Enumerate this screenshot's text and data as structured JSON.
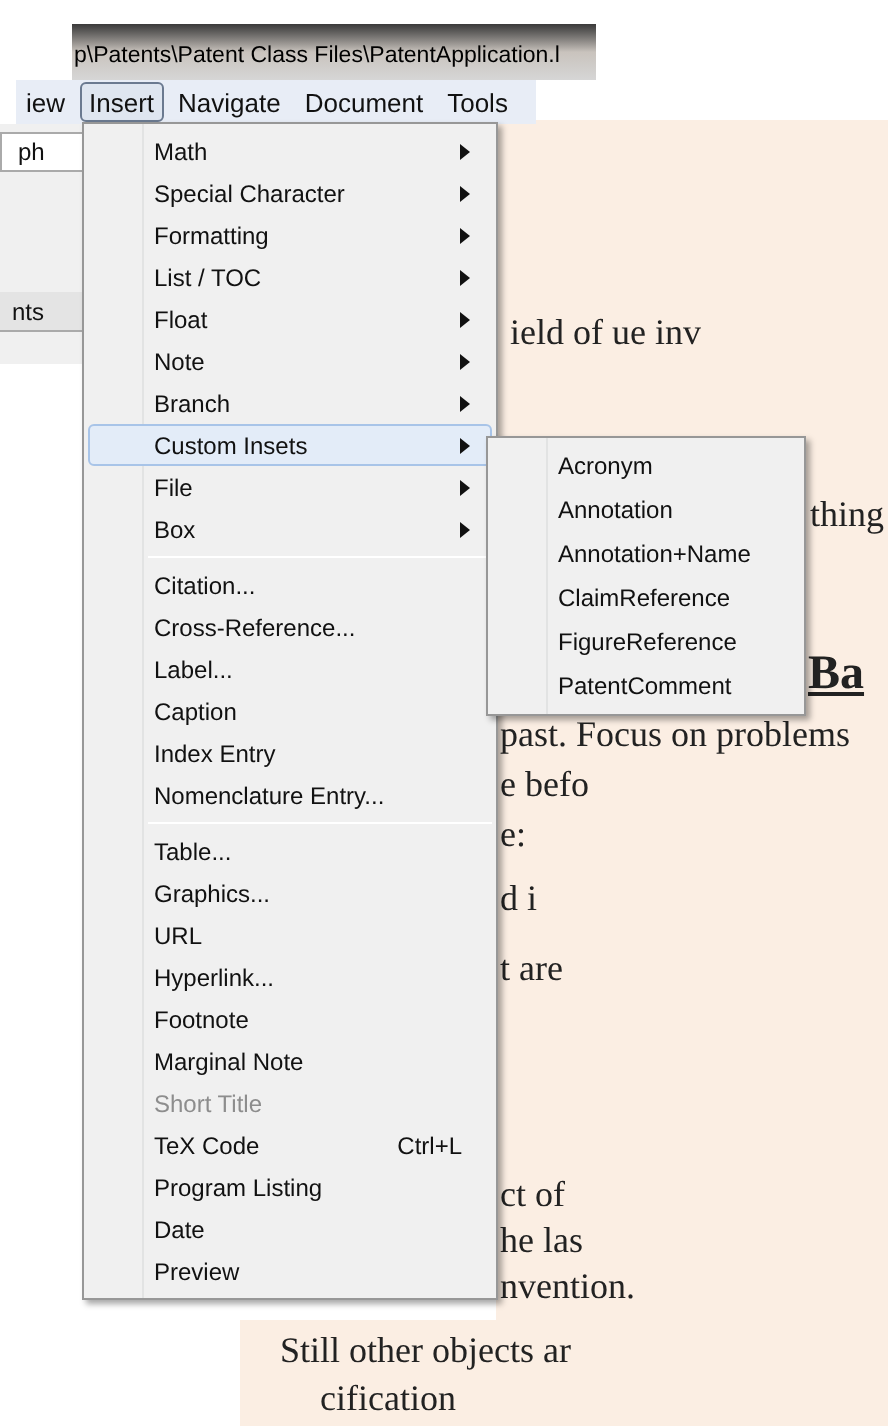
{
  "window": {
    "title": "p\\Patents\\Patent Class Files\\PatentApplication.l"
  },
  "menubar": [
    {
      "label": "iew",
      "selected": false
    },
    {
      "label": "Insert",
      "selected": true
    },
    {
      "label": "Navigate",
      "selected": false
    },
    {
      "label": "Document",
      "selected": false
    },
    {
      "label": "Tools",
      "selected": false
    }
  ],
  "sidebar": {
    "combo": "ph",
    "tab": "nts"
  },
  "insert_menu": [
    [
      {
        "label": "Math",
        "submenu": true,
        "selected": false,
        "disabled": false
      },
      {
        "label": "Special Character",
        "submenu": true,
        "selected": false,
        "disabled": false
      },
      {
        "label": "Formatting",
        "submenu": true,
        "selected": false,
        "disabled": false
      },
      {
        "label": "List / TOC",
        "submenu": true,
        "selected": false,
        "disabled": false
      },
      {
        "label": "Float",
        "submenu": true,
        "selected": false,
        "disabled": false
      },
      {
        "label": "Note",
        "submenu": true,
        "selected": false,
        "disabled": false
      },
      {
        "label": "Branch",
        "submenu": true,
        "selected": false,
        "disabled": false
      },
      {
        "label": "Custom Insets",
        "submenu": true,
        "selected": true,
        "disabled": false
      },
      {
        "label": "File",
        "submenu": true,
        "selected": false,
        "disabled": false
      },
      {
        "label": "Box",
        "submenu": true,
        "selected": false,
        "disabled": false
      }
    ],
    [
      {
        "label": "Citation...",
        "submenu": false,
        "selected": false,
        "disabled": false
      },
      {
        "label": "Cross-Reference...",
        "submenu": false,
        "selected": false,
        "disabled": false
      },
      {
        "label": "Label...",
        "submenu": false,
        "selected": false,
        "disabled": false
      },
      {
        "label": "Caption",
        "submenu": false,
        "selected": false,
        "disabled": false
      },
      {
        "label": "Index Entry",
        "submenu": false,
        "selected": false,
        "disabled": false
      },
      {
        "label": "Nomenclature Entry...",
        "submenu": false,
        "selected": false,
        "disabled": false
      }
    ],
    [
      {
        "label": "Table...",
        "submenu": false,
        "selected": false,
        "disabled": false
      },
      {
        "label": "Graphics...",
        "submenu": false,
        "selected": false,
        "disabled": false
      },
      {
        "label": "URL",
        "submenu": false,
        "selected": false,
        "disabled": false
      },
      {
        "label": "Hyperlink...",
        "submenu": false,
        "selected": false,
        "disabled": false
      },
      {
        "label": "Footnote",
        "submenu": false,
        "selected": false,
        "disabled": false
      },
      {
        "label": "Marginal Note",
        "submenu": false,
        "selected": false,
        "disabled": false
      },
      {
        "label": "Short Title",
        "submenu": false,
        "selected": false,
        "disabled": true
      },
      {
        "label": "TeX Code",
        "shortcut": "Ctrl+L",
        "submenu": false,
        "selected": false,
        "disabled": false
      },
      {
        "label": "Program Listing",
        "submenu": false,
        "selected": false,
        "disabled": false
      },
      {
        "label": "Date",
        "submenu": false,
        "selected": false,
        "disabled": false
      },
      {
        "label": "Preview",
        "submenu": false,
        "selected": false,
        "disabled": false
      }
    ]
  ],
  "custom_insets_submenu": [
    "Acronym",
    "Annotation",
    "Annotation+Name",
    "ClaimReference",
    "FigureReference",
    "PatentComment"
  ],
  "document_lines": [
    {
      "text": "ield of ue inv",
      "kind": "body"
    },
    {
      "text": "thing",
      "kind": "body"
    },
    {
      "text": "Ba",
      "kind": "heading"
    },
    {
      "text": "past. Focus on problems",
      "kind": "body"
    },
    {
      "text": "e befo",
      "kind": "body"
    },
    {
      "text": "e:",
      "kind": "body"
    },
    {
      "text": "d i",
      "kind": "body"
    },
    {
      "text": "t are",
      "kind": "body"
    },
    {
      "text": "ct of",
      "kind": "body"
    },
    {
      "text": "he las",
      "kind": "body"
    },
    {
      "text": "nvention.",
      "kind": "body"
    },
    {
      "text": "Still other objects ar",
      "kind": "body"
    },
    {
      "text": "cification",
      "kind": "body"
    }
  ]
}
